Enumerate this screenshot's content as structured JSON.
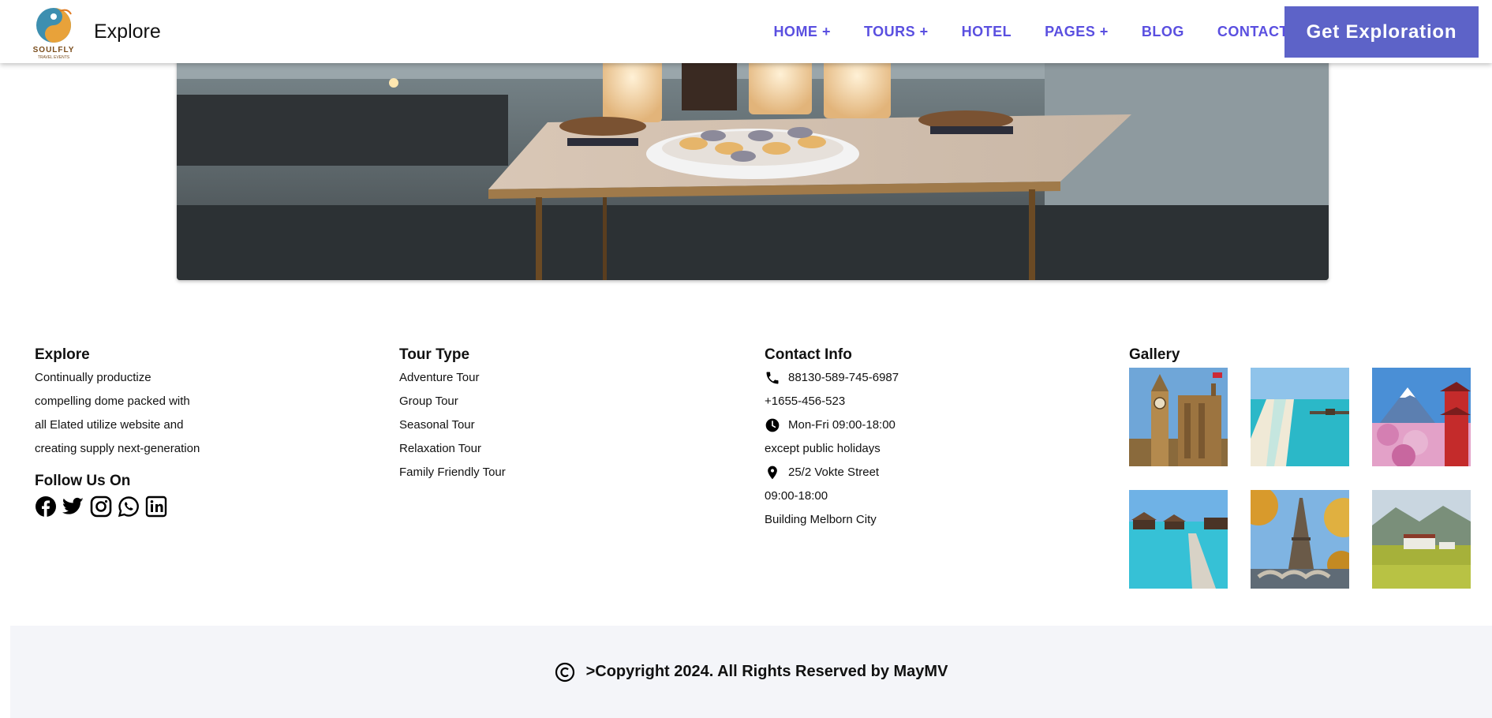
{
  "header": {
    "logo_text": "SOULFLY",
    "logo_subtext": "TRAVEL EVENTS",
    "brand": "Explore",
    "nav": [
      {
        "label": "HOME +"
      },
      {
        "label": "TOURS +"
      },
      {
        "label": "HOTEL"
      },
      {
        "label": "PAGES +"
      },
      {
        "label": "BLOG"
      },
      {
        "label": "CONTACT"
      }
    ],
    "cta": "Get Exploration"
  },
  "footer": {
    "explore": {
      "title": "Explore",
      "lines": [
        "Continually productize",
        "compelling dome packed with",
        "all Elated utilize website and",
        "creating supply next-generation"
      ],
      "follow": "Follow Us On",
      "socials": [
        "facebook-icon",
        "twitter-icon",
        "instagram-icon",
        "whatsapp-icon",
        "linkedin-icon"
      ]
    },
    "tour_type": {
      "title": "Tour Type",
      "items": [
        "Adventure Tour",
        "Group Tour",
        "Seasonal Tour",
        "Relaxation Tour",
        "Family Friendly Tour"
      ]
    },
    "contact": {
      "title": "Contact Info",
      "phone1": "88130-589-745-6987",
      "phone2": "+1655-456-523",
      "hours": "Mon-Fri 09:00-18:00",
      "hours_note": "except public holidays",
      "address1": "25/2 Vokte Street",
      "address2": "09:00-18:00",
      "address3": "Building Melborn City"
    },
    "gallery": {
      "title": "Gallery"
    }
  },
  "copyright": {
    "text": ">Copyright 2024. All Rights Reserved by MayMV"
  }
}
